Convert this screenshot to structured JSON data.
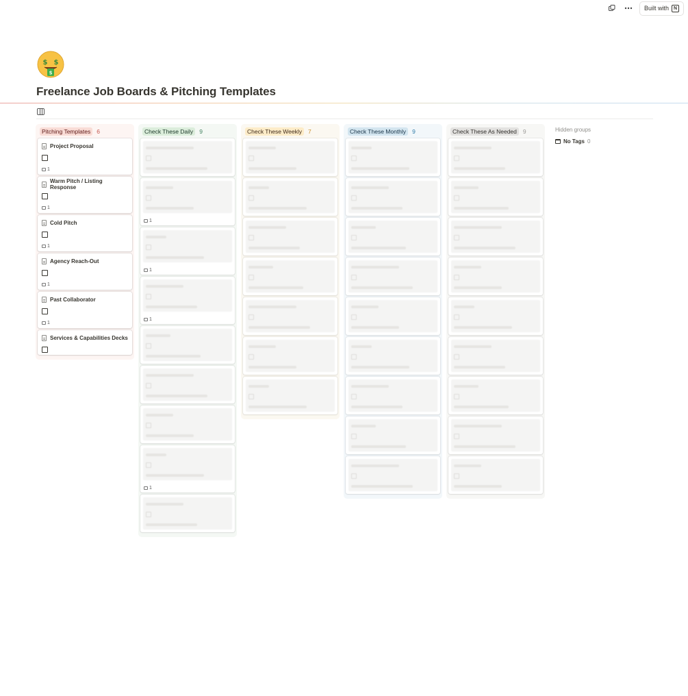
{
  "topbar": {
    "duplicate_icon": "duplicate-icon",
    "more_icon": "ellipsis-icon",
    "built_with": "Built with"
  },
  "page": {
    "icon": "money-mouth-face-emoji",
    "title": "Freelance Job Boards & Pitching Templates"
  },
  "view": {
    "icon": "board-view-icon"
  },
  "columns": [
    {
      "name": "Pitching Templates",
      "count": "6",
      "bg": "#fdf5f3",
      "pill_bg": "#f9dcd6",
      "pill_fg": "#5d1715",
      "count_fg": "#c4554d",
      "cards": [
        {
          "title": "Project Proposal",
          "comments": "1"
        },
        {
          "title": "Warm Pitch / Listing Response",
          "comments": "1"
        },
        {
          "title": "Cold Pitch",
          "comments": "1"
        },
        {
          "title": "Agency Reach-Out",
          "comments": "1"
        },
        {
          "title": "Past Collaborator",
          "comments": "1"
        },
        {
          "title": "Services & Capabilities Decks",
          "comments": ""
        }
      ]
    },
    {
      "name": "Check These Daily",
      "count": "9",
      "bg": "#f4f8f4",
      "pill_bg": "#dbeddb",
      "pill_fg": "#1c3829",
      "count_fg": "#448361",
      "faded_cards": [
        {
          "comments": ""
        },
        {
          "comments": "1"
        },
        {
          "comments": "1"
        },
        {
          "comments": "1"
        },
        {
          "comments": ""
        },
        {
          "comments": ""
        },
        {
          "comments": ""
        },
        {
          "comments": "1"
        },
        {
          "comments": ""
        }
      ]
    },
    {
      "name": "Check These Weekly",
      "count": "7",
      "bg": "#fbf8f1",
      "pill_bg": "#fdecc8",
      "pill_fg": "#402c1b",
      "count_fg": "#cb912f",
      "faded_cards": [
        {
          "comments": ""
        },
        {
          "comments": ""
        },
        {
          "comments": ""
        },
        {
          "comments": ""
        },
        {
          "comments": ""
        },
        {
          "comments": ""
        },
        {
          "comments": ""
        }
      ]
    },
    {
      "name": "Check These Monthly",
      "count": "9",
      "bg": "#f2f7fa",
      "pill_bg": "#d3e5ef",
      "pill_fg": "#183347",
      "count_fg": "#337ea9",
      "faded_cards": [
        {
          "comments": ""
        },
        {
          "comments": ""
        },
        {
          "comments": ""
        },
        {
          "comments": ""
        },
        {
          "comments": ""
        },
        {
          "comments": ""
        },
        {
          "comments": ""
        },
        {
          "comments": ""
        },
        {
          "comments": ""
        }
      ]
    },
    {
      "name": "Check These As Needed",
      "count": "9",
      "bg": "#f7f7f5",
      "pill_bg": "#e3e2e0",
      "pill_fg": "#32302c",
      "count_fg": "#9b9a97",
      "faded_cards": [
        {
          "comments": ""
        },
        {
          "comments": ""
        },
        {
          "comments": ""
        },
        {
          "comments": ""
        },
        {
          "comments": ""
        },
        {
          "comments": ""
        },
        {
          "comments": ""
        },
        {
          "comments": ""
        },
        {
          "comments": ""
        }
      ]
    }
  ],
  "hidden_groups": {
    "label": "Hidden groups",
    "items": [
      {
        "name": "No Tags",
        "count": "0"
      }
    ]
  }
}
